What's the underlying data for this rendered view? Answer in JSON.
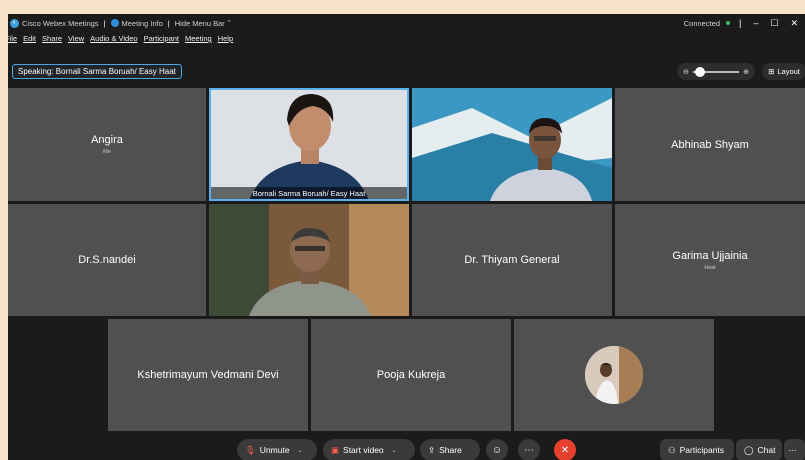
{
  "titlebar": {
    "app_name": "Cisco Webex Meetings",
    "meeting_info": "Meeting Info",
    "hide_menu": "Hide Menu Bar",
    "status": "Connected"
  },
  "menu": [
    "File",
    "Edit",
    "Share",
    "View",
    "Audio & Video",
    "Participant",
    "Meeting",
    "Help"
  ],
  "speaking_label": "Speaking: Bornali Sarma Boruah/ Easy Haat",
  "layout_label": "Layout",
  "tiles": [
    {
      "name": "Angira",
      "sub": "Me"
    },
    {
      "name": "Bornali Sarma Boruah/ Easy Haat"
    },
    {
      "name": ""
    },
    {
      "name": "Abhinab Shyam"
    },
    {
      "name": "Dr.S.nandei"
    },
    {
      "name": ""
    },
    {
      "name": "Dr. Thiyam General"
    },
    {
      "name": "Garima Ujjainia",
      "sub": "Host"
    },
    {
      "name": "Kshetrimayum Vedmani Devi"
    },
    {
      "name": "Pooja Kukreja"
    }
  ],
  "toolbar": {
    "unmute": "Unmute",
    "start_video": "Start video",
    "share": "Share",
    "participants": "Participants",
    "chat": "Chat"
  },
  "colors": {
    "accent": "#4aa7e6",
    "leave": "#e8402f",
    "tile": "#505050",
    "connected": "#38c172"
  }
}
